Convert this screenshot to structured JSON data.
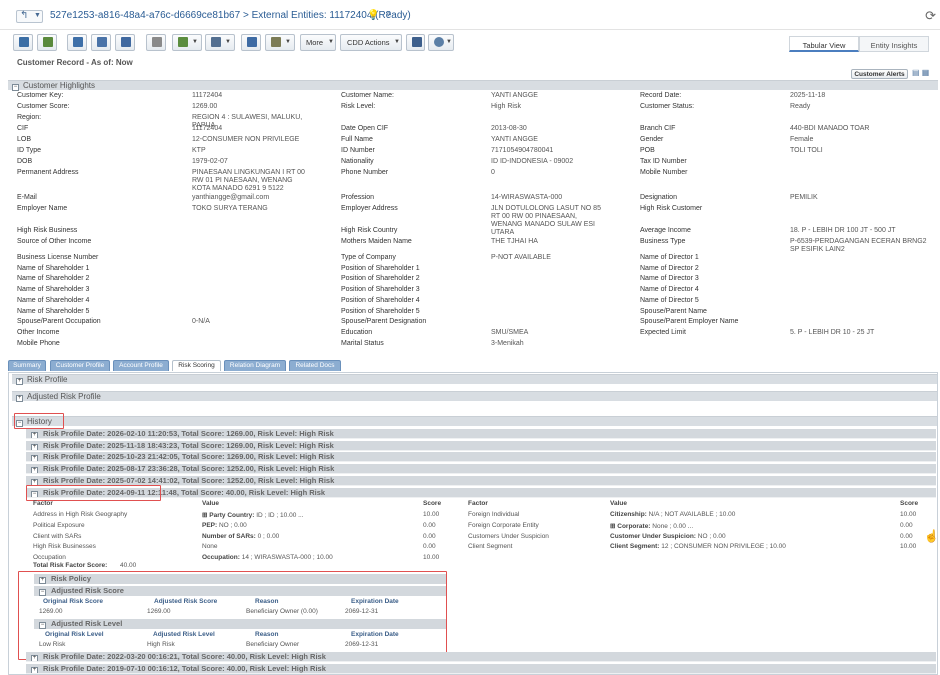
{
  "titlebar": {
    "title": "527e1253-a816-48a4-a76c-d6669ce81b67 > External Entities: 11172404 (Ready)",
    "back_icon": "back-arrow-icon",
    "help_icon": "help-icon",
    "bulb_icon": "lightbulb-icon",
    "refresh_icon": "refresh-icon"
  },
  "toolbar": {
    "more_label": "More",
    "cdd_label": "CDD Actions"
  },
  "view_tabs": [
    "Tabular View",
    "Entity Insights"
  ],
  "record": {
    "title": "Customer Record - As of: Now",
    "alerts_label": "Customer Alerts"
  },
  "highlights": {
    "header": "Customer Highlights",
    "fields": [
      {
        "label": "Customer Key:",
        "value": "11172404",
        "col": 0,
        "row": 0
      },
      {
        "label": "Customer Name:",
        "value": "YANTI ANGGE",
        "col": 1,
        "row": 0
      },
      {
        "label": "Record Date:",
        "value": "2025-11-18",
        "col": 2,
        "row": 0
      },
      {
        "label": "Customer Score:",
        "value": "1269.00",
        "col": 0,
        "row": 1
      },
      {
        "label": "Risk Level:",
        "value": "High Risk",
        "col": 1,
        "row": 1
      },
      {
        "label": "Customer Status:",
        "value": "Ready",
        "col": 2,
        "row": 1
      },
      {
        "label": "Region:",
        "value": "REGION 4 : SULAWESI, MALUKU, PAPUA",
        "col": 0,
        "row": 2
      },
      {
        "label": "CIF",
        "value": "11172404",
        "col": 0,
        "row": 3
      },
      {
        "label": "Date Open CIF",
        "value": "2013-08-30",
        "col": 1,
        "row": 3
      },
      {
        "label": "Branch CIF",
        "value": "440-BDI MANADO TOAR",
        "col": 2,
        "row": 3
      },
      {
        "label": "LOB",
        "value": "12-CONSUMER NON PRIVILEGE",
        "col": 0,
        "row": 4
      },
      {
        "label": "Full Name",
        "value": "YANTI ANGGE",
        "col": 1,
        "row": 4
      },
      {
        "label": "Gender",
        "value": "Female",
        "col": 2,
        "row": 4
      },
      {
        "label": "ID Type",
        "value": "KTP",
        "col": 0,
        "row": 5
      },
      {
        "label": "ID Number",
        "value": "7171054904780041",
        "col": 1,
        "row": 5
      },
      {
        "label": "POB",
        "value": "TOLI TOLI",
        "col": 2,
        "row": 5
      },
      {
        "label": "DOB",
        "value": "1979-02-07",
        "col": 0,
        "row": 6
      },
      {
        "label": "Nationality",
        "value": "ID ID-INDONESIA - 09002",
        "col": 1,
        "row": 6
      },
      {
        "label": "Tax ID Number",
        "value": "",
        "col": 2,
        "row": 6
      },
      {
        "label": "Permanent Address",
        "value": "PINAESAAN LINGKUNGAN I RT 00 RW 01 PI NAESAAN, WENANG KOTA MANADO 6291 9 5122",
        "col": 0,
        "row": 7
      },
      {
        "label": "Phone Number",
        "value": "0",
        "col": 1,
        "row": 7
      },
      {
        "label": "Mobile Number",
        "value": "",
        "col": 2,
        "row": 7
      },
      {
        "label": "E-Mail",
        "value": "yanthiangge@gmail.com",
        "col": 0,
        "row": 8
      },
      {
        "label": "Profession",
        "value": "14-WIRASWASTA-000",
        "col": 1,
        "row": 8
      },
      {
        "label": "Designation",
        "value": "PEMILIK",
        "col": 2,
        "row": 8
      },
      {
        "label": "Employer Name",
        "value": "TOKO SURYA TERANG",
        "col": 0,
        "row": 9
      },
      {
        "label": "Employer Address",
        "value": "JLN DOTULOLONG LASUT NO 85 RT 00 RW 00 PINAESAAN, WENANG MANADO SULAW ESI UTARA",
        "col": 1,
        "row": 9
      },
      {
        "label": "High Risk Customer",
        "value": "",
        "col": 2,
        "row": 9
      },
      {
        "label": "High Risk Business",
        "value": "",
        "col": 0,
        "row": 10
      },
      {
        "label": "High Risk Country",
        "value": "",
        "col": 1,
        "row": 10
      },
      {
        "label": "Average Income",
        "value": "18. P - LEBIH DR 100 JT - 500 JT",
        "col": 2,
        "row": 10
      },
      {
        "label": "Source of Other Income",
        "value": "",
        "col": 0,
        "row": 11
      },
      {
        "label": "Mothers Maiden Name",
        "value": "THE TJHAI HA",
        "col": 1,
        "row": 11
      },
      {
        "label": "Business Type",
        "value": "P-6539-PERDAGANGAN ECERAN BRNG2 SP ESIFIK LAIN2",
        "col": 2,
        "row": 11
      },
      {
        "label": "Business License Number",
        "value": "",
        "col": 0,
        "row": 12
      },
      {
        "label": "Type of Company",
        "value": "P-NOT AVAILABLE",
        "col": 1,
        "row": 12
      },
      {
        "label": "Name of Director 1",
        "value": "",
        "col": 2,
        "row": 12
      },
      {
        "label": "Name of Shareholder 1",
        "value": "",
        "col": 0,
        "row": 13
      },
      {
        "label": "Position of Shareholder 1",
        "value": "",
        "col": 1,
        "row": 13
      },
      {
        "label": "Name of Director 2",
        "value": "",
        "col": 2,
        "row": 13
      },
      {
        "label": "Name of Shareholder 2",
        "value": "",
        "col": 0,
        "row": 14
      },
      {
        "label": "Position of Shareholder 2",
        "value": "",
        "col": 1,
        "row": 14
      },
      {
        "label": "Name of Director 3",
        "value": "",
        "col": 2,
        "row": 14
      },
      {
        "label": "Name of Shareholder 3",
        "value": "",
        "col": 0,
        "row": 15
      },
      {
        "label": "Position of Shareholder 3",
        "value": "",
        "col": 1,
        "row": 15
      },
      {
        "label": "Name of Director 4",
        "value": "",
        "col": 2,
        "row": 15
      },
      {
        "label": "Name of Shareholder 4",
        "value": "",
        "col": 0,
        "row": 16
      },
      {
        "label": "Position of Shareholder 4",
        "value": "",
        "col": 1,
        "row": 16
      },
      {
        "label": "Name of Director 5",
        "value": "",
        "col": 2,
        "row": 16
      },
      {
        "label": "Name of Shareholder 5",
        "value": "",
        "col": 0,
        "row": 17
      },
      {
        "label": "Position of Shareholder 5",
        "value": "",
        "col": 1,
        "row": 17
      },
      {
        "label": "Spouse/Parent Name",
        "value": "",
        "col": 2,
        "row": 17
      },
      {
        "label": "Spouse/Parent Occupation",
        "value": "0-N/A",
        "col": 0,
        "row": 18
      },
      {
        "label": "Spouse/Parent Designation",
        "value": "",
        "col": 1,
        "row": 18
      },
      {
        "label": "Spouse/Parent Employer Name",
        "value": "",
        "col": 2,
        "row": 18
      },
      {
        "label": "Other Income",
        "value": "",
        "col": 0,
        "row": 19
      },
      {
        "label": "Education",
        "value": "SMU/SMEA",
        "col": 1,
        "row": 19
      },
      {
        "label": "Expected Limit",
        "value": "5. P - LEBIH DR 10 - 25 JT",
        "col": 2,
        "row": 19
      },
      {
        "label": "Mobile Phone",
        "value": "",
        "col": 0,
        "row": 20
      },
      {
        "label": "Marital Status",
        "value": "3-Menikah",
        "col": 1,
        "row": 20
      }
    ]
  },
  "detail_tabs": [
    "Summary",
    "Customer Profile",
    "Account Profile",
    "Risk Scoring",
    "Relation Diagram",
    "Related Docs"
  ],
  "risk": {
    "risk_profile": "Risk Profile",
    "adjusted_risk_profile": "Adjusted Risk Profile",
    "history": "History",
    "history_rows": [
      "Risk Profile Date: 2026-02-10 11:20:53, Total Score: 1269.00, Risk Level: High Risk",
      "Risk Profile Date: 2025-11-18 18:43:23, Total Score: 1269.00, Risk Level: High Risk",
      "Risk Profile Date: 2025-10-23 21:42:05, Total Score: 1269.00, Risk Level: High Risk",
      "Risk Profile Date: 2025-08-17 23:36:28, Total Score: 1252.00, Risk Level: High Risk",
      "Risk Profile Date: 2025-07-02 14:41:02, Total Score: 1252.00, Risk Level: High Risk",
      "Risk Profile Date: 2024-09-11 12:11:48, Total Score: 40.00, Risk Level: High Risk"
    ],
    "factor_headers": [
      "Factor",
      "Value",
      "Score",
      "Factor",
      "Value",
      "Score"
    ],
    "factors_left": [
      {
        "factor": "Address in High Risk Geography",
        "key": "Party Country:",
        "val": " ID ; ID ; 10.00 ...",
        "score": "10.00"
      },
      {
        "factor": "Political Exposure",
        "key": "PEP:",
        "val": " NO ; 0.00",
        "score": "0.00"
      },
      {
        "factor": "Client with SARs",
        "key": "Number of SARs:",
        "val": " 0 ; 0.00",
        "score": "0.00"
      },
      {
        "factor": "High Risk Businesses",
        "key": "",
        "val": "None",
        "score": "0.00"
      },
      {
        "factor": "Occupation",
        "key": "Occupation:",
        "val": " 14 ; WIRASWASTA-000 ; 10.00",
        "score": "10.00"
      }
    ],
    "factors_right": [
      {
        "factor": "Foreign Individual",
        "key": "Citizenship:",
        "val": " N/A ; NOT AVAILABLE ; 10.00",
        "score": "10.00"
      },
      {
        "factor": "Foreign Corporate Entity",
        "key": "Corporate:",
        "val": " None ; 0.00 ...",
        "score": "0.00"
      },
      {
        "factor": "Customers Under Suspicion",
        "key": "Customer Under Suspicion:",
        "val": " NO ; 0.00",
        "score": "0.00"
      },
      {
        "factor": "Client Segment",
        "key": "Client Segment:",
        "val": " 12 ; CONSUMER NON PRIVILEGE ; 10.00",
        "score": "10.00"
      }
    ],
    "total_label": "Total Risk Factor Score:",
    "total_value": "40.00",
    "risk_policy": "Risk Policy",
    "adjusted_risk_score": "Adjusted Risk Score",
    "score_headers": [
      "Original Risk Score",
      "Adjusted Risk Score",
      "Reason",
      "Expiration Date"
    ],
    "score_row": [
      "1269.00",
      "1269.00",
      "Beneficiary Owner (0.00)",
      "2069-12-31"
    ],
    "adjusted_risk_level": "Adjusted Risk Level",
    "level_headers": [
      "Original Risk Level",
      "Adjusted Risk Level",
      "Reason",
      "Expiration Date"
    ],
    "level_row": [
      "Low Risk",
      "High Risk",
      "Beneficiary Owner",
      "2069-12-31"
    ],
    "older_rows": [
      "Risk Profile Date: 2022-03-20 00:16:21, Total Score: 40.00, Risk Level: High Risk",
      "Risk Profile Date: 2019-07-10 00:16:12, Total Score: 40.00, Risk Level: High Risk"
    ]
  }
}
